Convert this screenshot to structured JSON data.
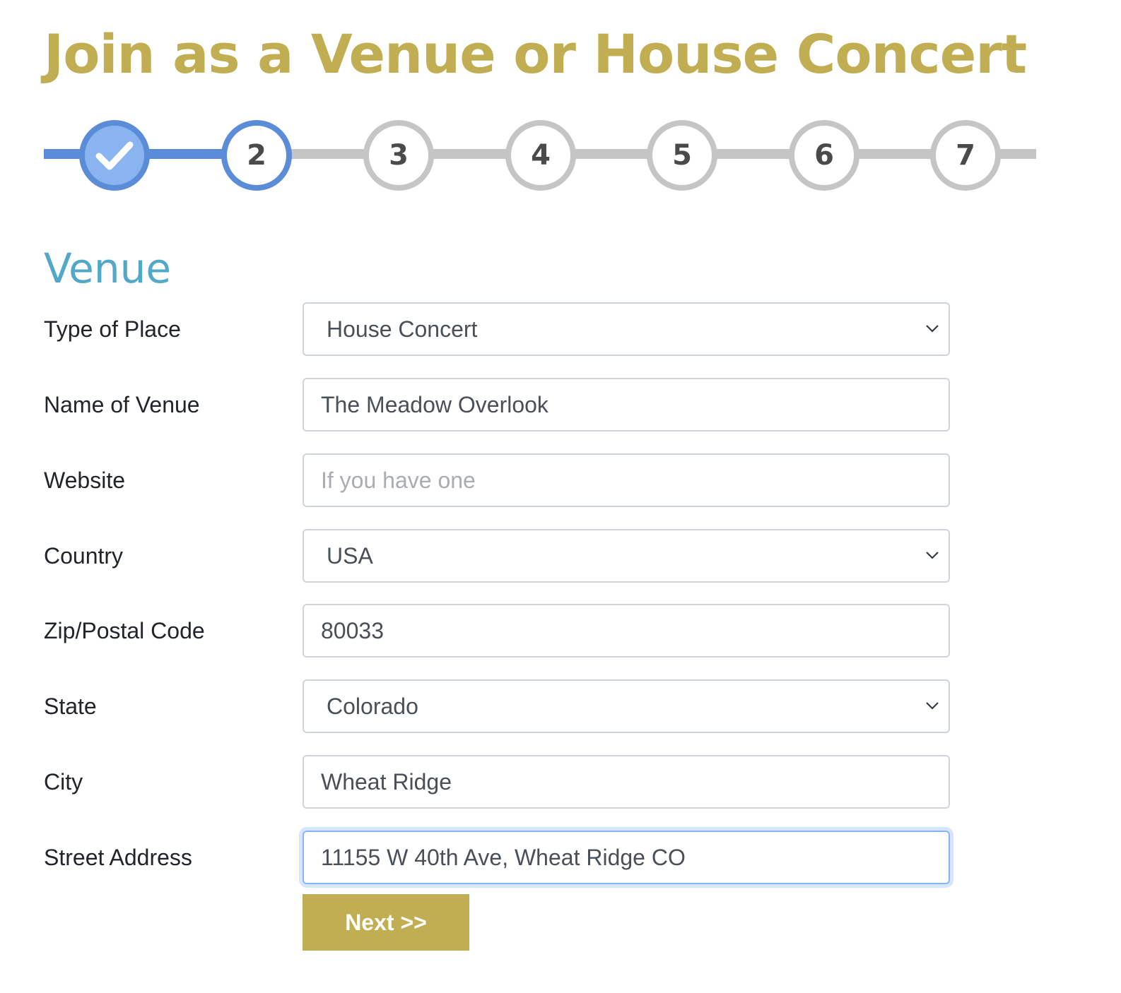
{
  "page": {
    "title": "Join as a Venue or House Concert",
    "accent_color": "#c2ae52",
    "section_color": "#52a8c9",
    "progress_color": "#5b8cd8"
  },
  "stepper": {
    "completed_icon": "check-icon",
    "current_step": 2,
    "steps": [
      {
        "label": "",
        "state": "done"
      },
      {
        "label": "2",
        "state": "current"
      },
      {
        "label": "3",
        "state": "todo"
      },
      {
        "label": "4",
        "state": "todo"
      },
      {
        "label": "5",
        "state": "todo"
      },
      {
        "label": "6",
        "state": "todo"
      },
      {
        "label": "7",
        "state": "todo"
      }
    ]
  },
  "form": {
    "section_title": "Venue",
    "type_of_place": {
      "label": "Type of Place",
      "value": "House Concert"
    },
    "name_of_venue": {
      "label": "Name of Venue",
      "value": "The Meadow Overlook"
    },
    "website": {
      "label": "Website",
      "value": "",
      "placeholder": "If you have one"
    },
    "country": {
      "label": "Country",
      "value": "USA"
    },
    "zip": {
      "label": "Zip/Postal Code",
      "value": "80033"
    },
    "state": {
      "label": "State",
      "value": "Colorado"
    },
    "city": {
      "label": "City",
      "value": "Wheat Ridge"
    },
    "street_address": {
      "label": "Street Address",
      "value": "11155 W 40th Ave, Wheat Ridge CO"
    },
    "next_label": "Next >>"
  }
}
